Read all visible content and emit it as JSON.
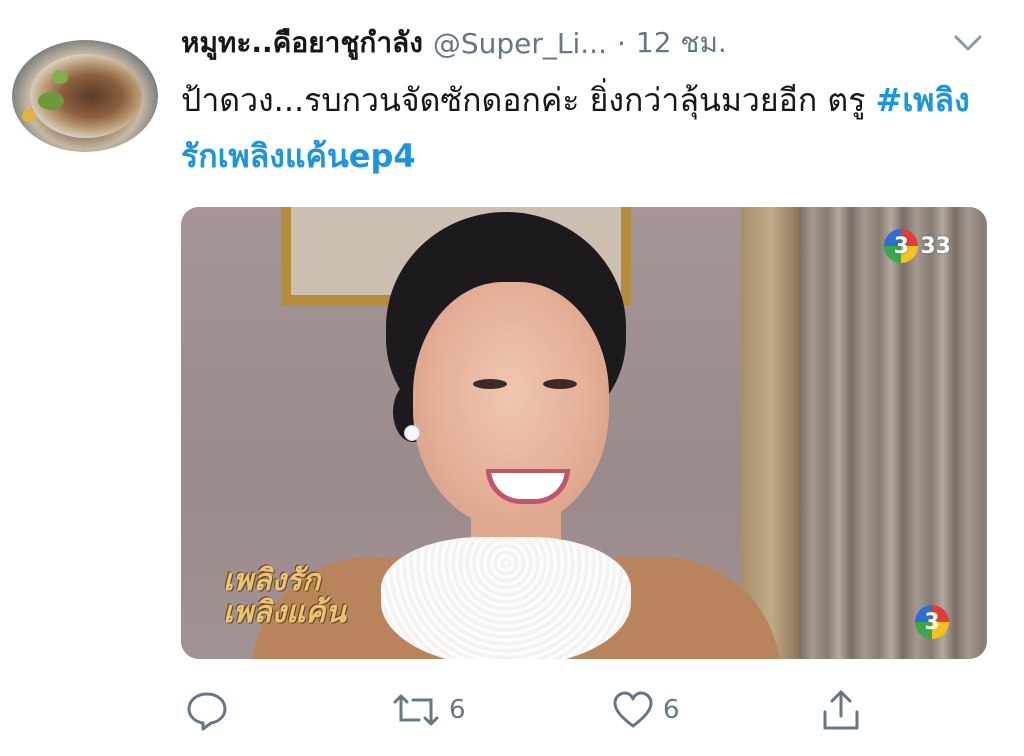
{
  "tweet": {
    "author_name": "หมูทะ..คือยาชูกำลัง",
    "handle": "@Super_Li...",
    "separator": "·",
    "time": "12 ชม.",
    "text_before": "ป้าดวง...รบกวนจัดซักดอกค่ะ ยิ่งกว่าลุ้นมวยอีก ตรู",
    "hashtag": "#เพลิงรักเพลิงแค้นep4"
  },
  "media": {
    "channel_badge": "33",
    "channel_ring": "3",
    "show_logo_line1": "เพลิงรัก",
    "show_logo_line2": "เพลิงแค้น"
  },
  "actions": {
    "reply_count": "",
    "retweet_count": "6",
    "like_count": "6"
  },
  "icons": [
    "chevron-down-icon",
    "reply-icon",
    "retweet-icon",
    "like-icon",
    "share-icon"
  ],
  "colors": {
    "link": "#1b95e0",
    "secondary": "#657786",
    "text": "#14171a"
  }
}
